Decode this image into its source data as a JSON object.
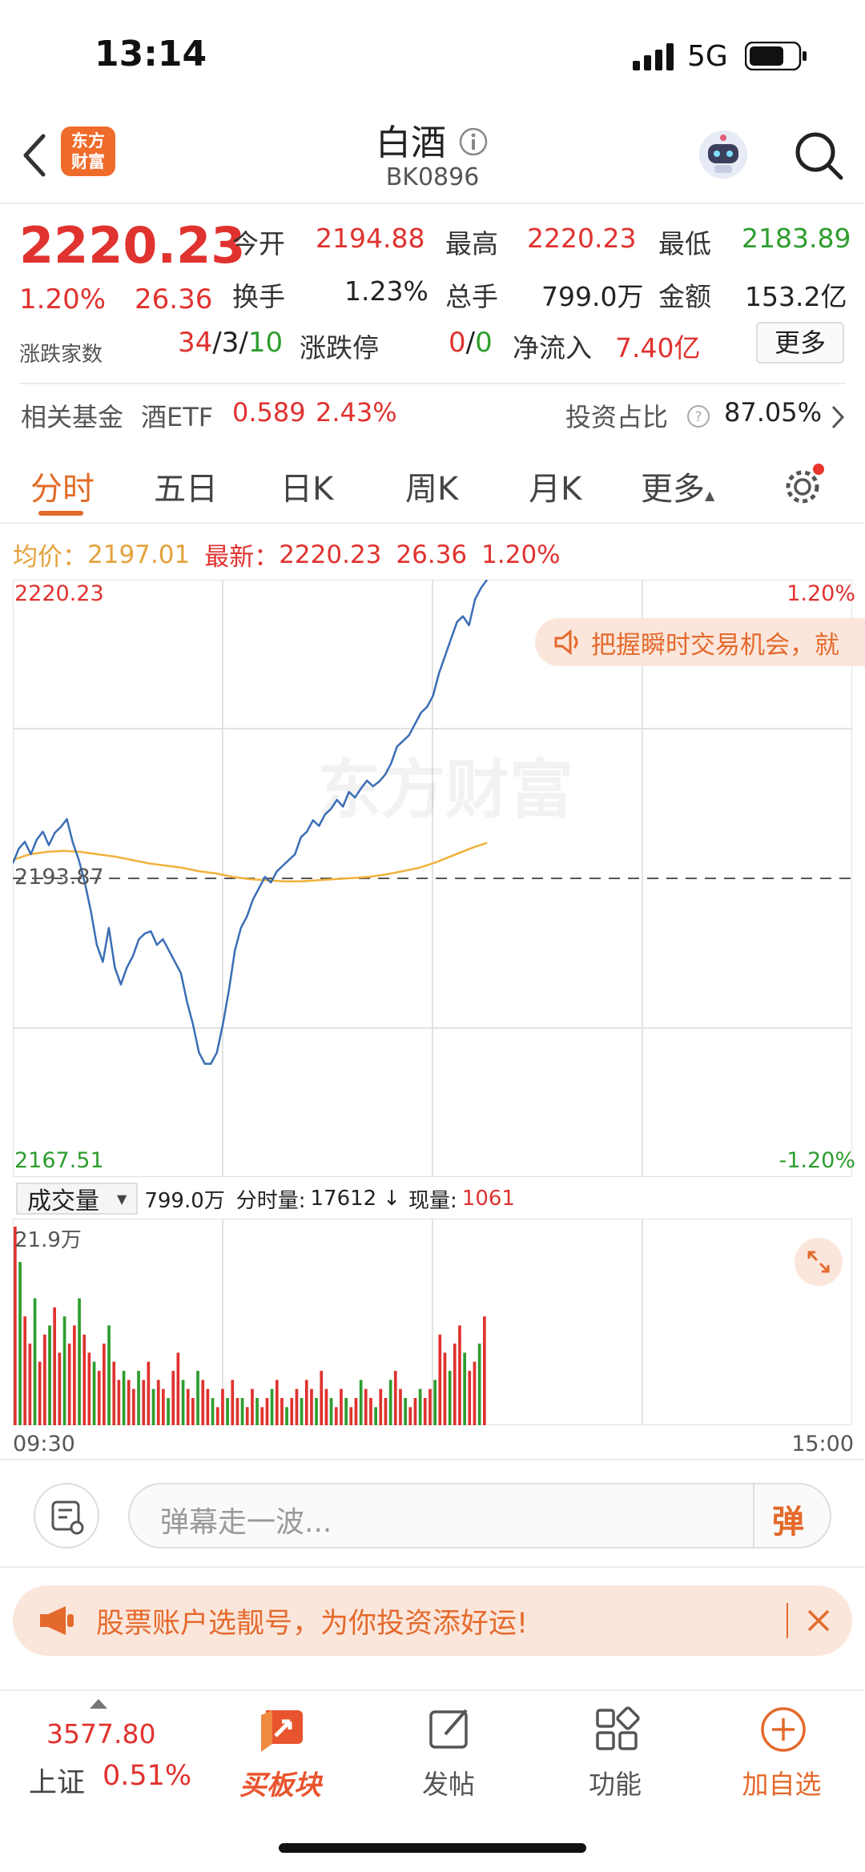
{
  "status_bar": {
    "time": "13:14",
    "network": "5G"
  },
  "header": {
    "back_label": "<",
    "logo_text_1": "东方",
    "logo_text_2": "财富",
    "title": "白酒",
    "code": "BK0896"
  },
  "quote": {
    "price": "2220.23",
    "pct": "1.20%",
    "change": "26.36",
    "open_label": "今开",
    "open": "2194.88",
    "high_label": "最高",
    "high": "2220.23",
    "low_label": "最低",
    "low": "2183.89",
    "turnover_label": "换手",
    "turnover": "1.23%",
    "volume_label": "总手",
    "volume": "799.0万",
    "amount_label": "金额",
    "amount": "153.2亿",
    "breadth_label": "涨跌家数",
    "breadth_up": "34",
    "breadth_sep1": "/",
    "breadth_flat": "3",
    "breadth_sep2": "/",
    "breadth_down": "10",
    "limit_label": "涨跌停",
    "limit_up": "0",
    "limit_sep": "/",
    "limit_down": "0",
    "inflow_label": "净流入",
    "inflow": "7.40亿",
    "more_label": "更多"
  },
  "fund": {
    "label": "相关基金",
    "name": "酒ETF",
    "price": "0.589",
    "pct": "2.43%",
    "ratio_label": "投资占比",
    "ratio": "87.05%"
  },
  "tabs": [
    "分时",
    "五日",
    "日K",
    "周K",
    "月K",
    "更多"
  ],
  "chart_legend": {
    "avg_label": "均价：",
    "avg": "2197.01",
    "latest_label": "最新：",
    "latest": "2220.23",
    "latest_change": "26.36",
    "latest_pct": "1.20%"
  },
  "chart_banner": "把握瞬时交易机会，就",
  "watermark": "东方财富",
  "volume_header": {
    "selector": "成交量",
    "total": "799.0万",
    "tick_label": "分时量:",
    "tick": "17612",
    "arrow": "↓",
    "now_label": "现量:",
    "now": "1061"
  },
  "comment_bar": {
    "placeholder": "弹幕走一波...",
    "danmu_label": "弹"
  },
  "promo": {
    "text": "股票账户选靓号，为你投资添好运!"
  },
  "bottom_nav": {
    "index_value": "3577.80",
    "index_name": "上证",
    "index_pct": "0.51%",
    "items": [
      "买板块",
      "发帖",
      "功能",
      "加自选"
    ]
  },
  "colors": {
    "up": "#e0322f",
    "down": "#2e9d2e",
    "line": "#3a6db5",
    "avg": "#f0b23a",
    "accent": "#ef6b2a"
  },
  "chart_data": {
    "type": "line",
    "x_start": "09:30",
    "x_end": "15:00",
    "y_axis_labels": {
      "top": "2220.23",
      "mid": "2193.87",
      "bottom": "2167.51",
      "top_pct": "1.20%",
      "bottom_pct": "-1.20%"
    },
    "ylim": [
      2167.51,
      2220.23
    ],
    "prev_close": 2193.87,
    "series": [
      {
        "name": "最新",
        "values": [
          2195.2,
          2196.5,
          2197.1,
          2196.0,
          2197.3,
          2198.0,
          2196.8,
          2197.9,
          2198.4,
          2199.1,
          2197.0,
          2195.5,
          2193.5,
          2191.0,
          2188.0,
          2186.5,
          2189.5,
          2186.0,
          2184.5,
          2186.0,
          2187.0,
          2188.5,
          2189.0,
          2189.2,
          2188.0,
          2188.5,
          2187.5,
          2186.5,
          2185.5,
          2183.0,
          2181.0,
          2178.5,
          2177.5,
          2177.5,
          2178.5,
          2181.0,
          2184.0,
          2187.5,
          2189.5,
          2190.5,
          2192.0,
          2193.0,
          2194.0,
          2193.5,
          2194.5,
          2195.0,
          2195.5,
          2196.0,
          2197.5,
          2198.0,
          2199.0,
          2198.5,
          2199.5,
          2200.0,
          2200.8,
          2200.2,
          2201.5,
          2201.0,
          2201.8,
          2202.5,
          2202.0,
          2202.4,
          2203.0,
          2204.0,
          2205.5,
          2206.0,
          2206.5,
          2207.5,
          2208.5,
          2209.0,
          2210.0,
          2212.0,
          2213.5,
          2215.0,
          2216.5,
          2217.0,
          2216.2,
          2218.5,
          2219.5,
          2220.23
        ]
      },
      {
        "name": "均价",
        "values": [
          2195.5,
          2196.0,
          2196.2,
          2196.3,
          2196.2,
          2196.0,
          2195.8,
          2195.5,
          2195.2,
          2195.0,
          2194.8,
          2194.5,
          2194.3,
          2194.0,
          2193.8,
          2193.7,
          2193.6,
          2193.6,
          2193.7,
          2193.8,
          2193.9,
          2194.0,
          2194.2,
          2194.5,
          2194.8,
          2195.3,
          2195.9,
          2196.5,
          2197.01
        ]
      }
    ],
    "volume": {
      "max_label": "21.9万",
      "bars": [
        21.9,
        18,
        12,
        9,
        14,
        7,
        10,
        11,
        13,
        8,
        12,
        9,
        11,
        14,
        10,
        8,
        7,
        6,
        9,
        11,
        7,
        5,
        6,
        5,
        4,
        6,
        5,
        7,
        4,
        5,
        4,
        3,
        6,
        8,
        5,
        4,
        3,
        6,
        5,
        4,
        3,
        2,
        4,
        3,
        5,
        3,
        3,
        2,
        4,
        3,
        2,
        3,
        4,
        5,
        3,
        2,
        3,
        4,
        3,
        5,
        4,
        3,
        6,
        4,
        3,
        2,
        4,
        3,
        2,
        3,
        5,
        4,
        3,
        2,
        4,
        3,
        5,
        6,
        4,
        3,
        2,
        3,
        4,
        3,
        4,
        5,
        10,
        8,
        6,
        9,
        11,
        8,
        6,
        7,
        9,
        12
      ]
    }
  }
}
